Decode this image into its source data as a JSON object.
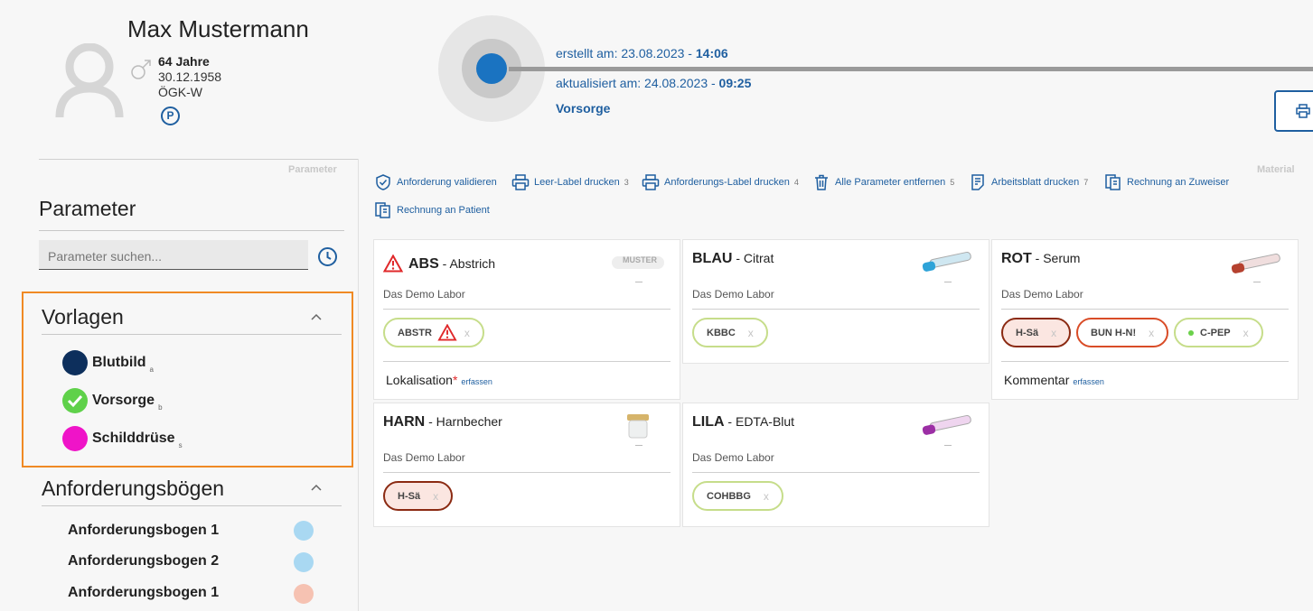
{
  "patient": {
    "name": "Max Mustermann",
    "age": "64 Jahre",
    "birthdate": "30.12.1958",
    "insurance": "ÖGK-W",
    "p_badge": "P"
  },
  "request": {
    "created_label": "erstellt am: 23.08.2023 - ",
    "created_time": "14:06",
    "updated_label": "aktualisiert am: 24.08.2023 - ",
    "updated_time": "09:25",
    "type": "Vorsorge"
  },
  "labels": {
    "parameter_faint": "Parameter",
    "material_faint": "Material"
  },
  "left": {
    "title": "Parameter",
    "search_placeholder": "Parameter suchen...",
    "vorlagen_title": "Vorlagen",
    "vorlagen": [
      {
        "name": "Blutbild",
        "key": "a",
        "color": "#0d2f5c"
      },
      {
        "name": "Vorsorge",
        "key": "b",
        "color": "#5fd14a"
      },
      {
        "name": "Schilddrüse",
        "key": "s",
        "color": "#ef14c8"
      }
    ],
    "boegen_title": "Anforderungsbögen",
    "boegen": [
      {
        "name": "Anforderungsbogen 1",
        "color": "#a9d8f2"
      },
      {
        "name": "Anforderungsbogen 2",
        "color": "#a9d8f2"
      },
      {
        "name": "Anforderungsbogen 1",
        "color": "#f6c2b2"
      }
    ]
  },
  "toolbar": [
    {
      "label": "Anforderung validieren",
      "num": "",
      "icon": "shield-check-icon"
    },
    {
      "label": "Leer-Label drucken",
      "num": "3",
      "icon": "printer-icon"
    },
    {
      "label": "Anforderungs-Label drucken",
      "num": "4",
      "icon": "printer-icon"
    },
    {
      "label": "Alle Parameter entfernen",
      "num": "5",
      "icon": "trash-icon"
    },
    {
      "label": "Arbeitsblatt drucken",
      "num": "7",
      "icon": "worksheet-icon"
    },
    {
      "label": "Rechnung an Zuweiser",
      "num": "",
      "icon": "invoice-icon"
    },
    {
      "label": "Rechnung an Patient",
      "num": "",
      "icon": "invoice-icon"
    }
  ],
  "cards": {
    "abs": {
      "code": "ABS",
      "name": " - Abstrich",
      "lab": "Das Demo Labor",
      "tube_text": "MUSTER",
      "params": [
        {
          "code": "ABSTR",
          "x": "x"
        }
      ],
      "field": "Lokalisation",
      "field_req": "*",
      "field_action": "erfassen"
    },
    "blau": {
      "code": "BLAU",
      "name": " - Citrat",
      "lab": "Das Demo Labor",
      "params": [
        {
          "code": "KBBC",
          "x": "x"
        }
      ]
    },
    "rot": {
      "code": "ROT",
      "name": " - Serum",
      "lab": "Das Demo Labor",
      "params": [
        {
          "code": "H-Sä",
          "x": "x"
        },
        {
          "code": "BUN H-N!",
          "x": "x"
        },
        {
          "code": "C-PEP",
          "x": "x"
        }
      ],
      "field": "Kommentar",
      "field_action": "erfassen"
    },
    "harn": {
      "code": "HARN",
      "name": " - Harnbecher",
      "lab": "Das Demo Labor",
      "params": [
        {
          "code": "H-Sä",
          "x": "x"
        }
      ]
    },
    "lila": {
      "code": "LILA",
      "name": " - EDTA-Blut",
      "lab": "Das Demo Labor",
      "params": [
        {
          "code": "COHBBG",
          "x": "x"
        }
      ]
    }
  },
  "colors": {
    "accent": "#1f5fa0",
    "highlight_border": "#f08a24",
    "pill_default": "#c6dd8a",
    "pill_dark_red": "#8b2a12",
    "pill_red": "#d94c27",
    "warning": "#e0282a"
  }
}
